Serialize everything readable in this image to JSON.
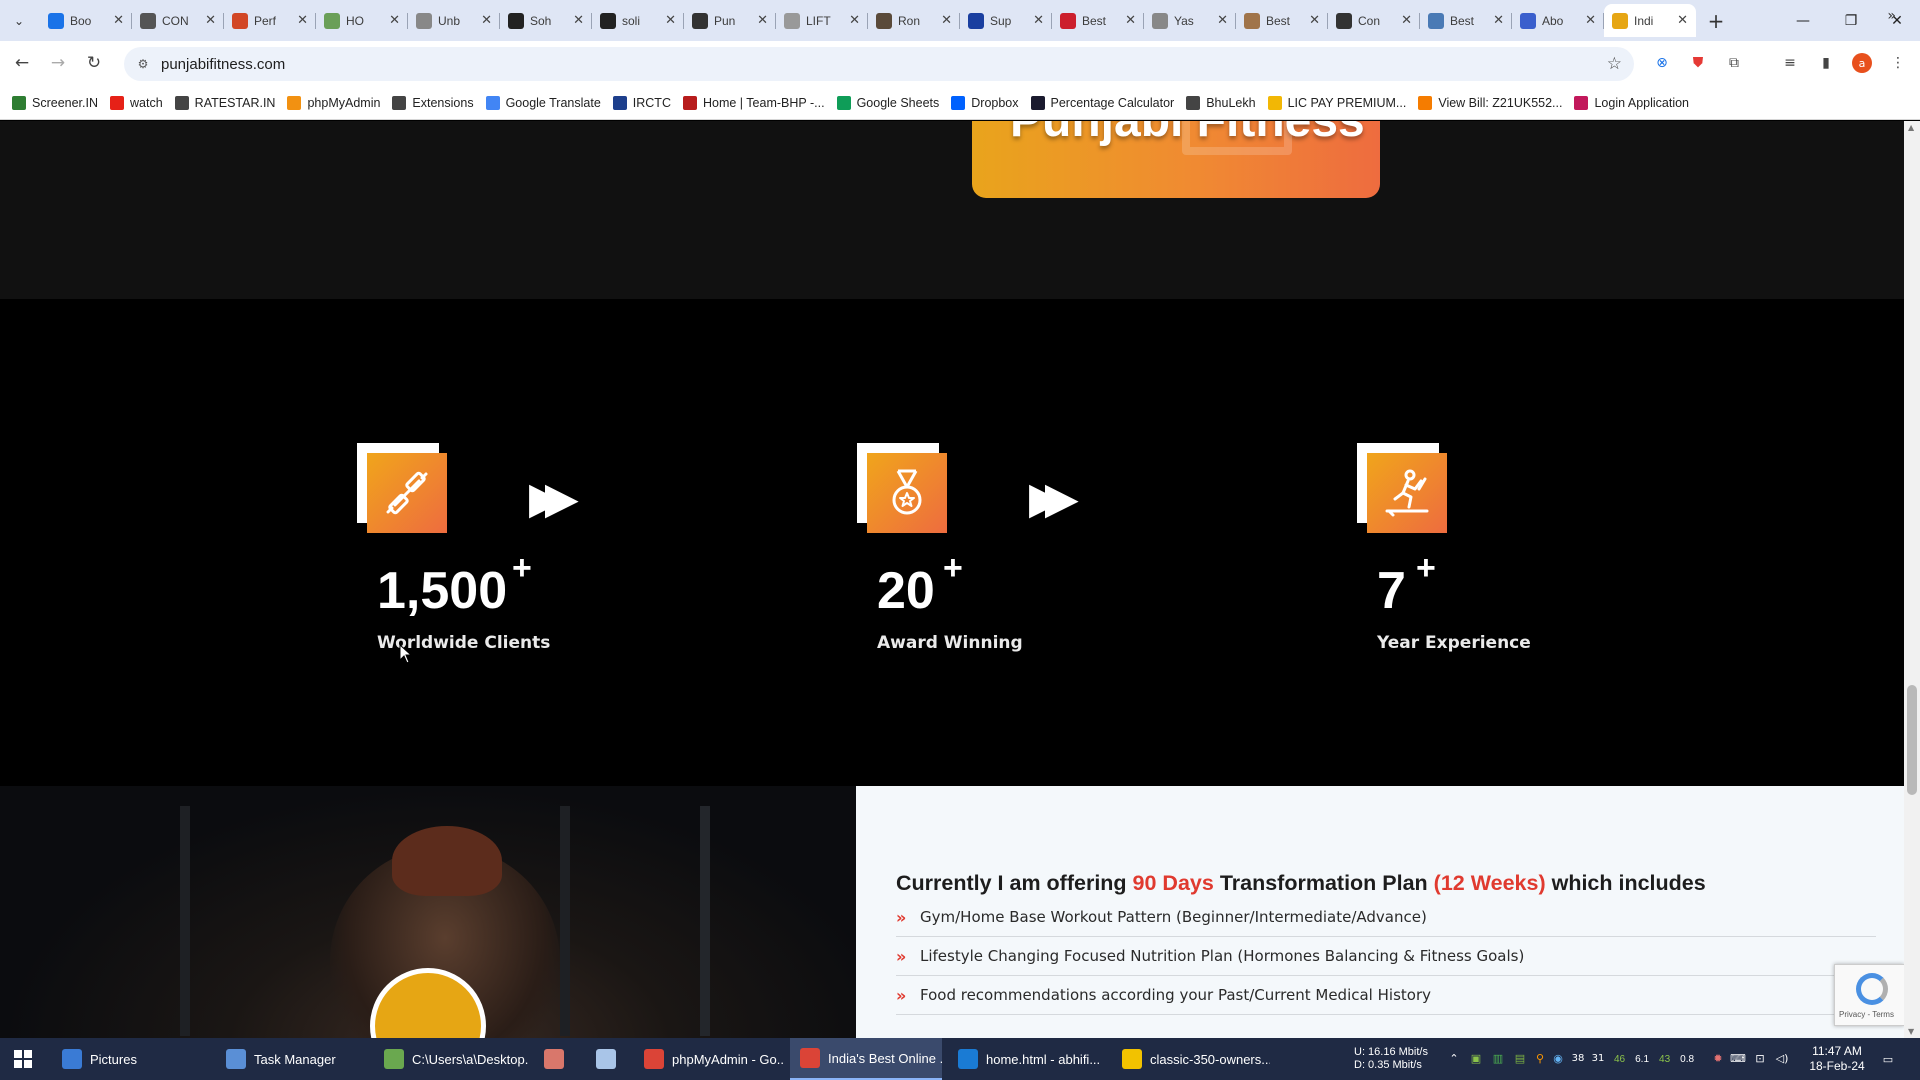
{
  "browser": {
    "tabs": [
      {
        "title": "Boo",
        "icon": "star-icon",
        "color": "#1a73e8"
      },
      {
        "title": "CON",
        "icon": "page-icon",
        "color": "#555555"
      },
      {
        "title": "Perf",
        "icon": "powerpoint-icon",
        "color": "#d24726"
      },
      {
        "title": "HO",
        "icon": "check-icon",
        "color": "#6a9f58"
      },
      {
        "title": "Unb",
        "icon": "doc-icon",
        "color": "#888888"
      },
      {
        "title": "Soh",
        "icon": "ssl-icon",
        "color": "#222222"
      },
      {
        "title": "soli",
        "icon": "s-icon",
        "color": "#222222"
      },
      {
        "title": "Pun",
        "icon": "dash-icon",
        "color": "#333333"
      },
      {
        "title": "LIFT",
        "icon": "doc-icon",
        "color": "#999999"
      },
      {
        "title": "Ron",
        "icon": "rs-icon",
        "color": "#5a4a3a"
      },
      {
        "title": "Sup",
        "icon": "circle-icon",
        "color": "#1a3fa0"
      },
      {
        "title": "Best",
        "icon": "flag-icon",
        "color": "#cc1f2d"
      },
      {
        "title": "Yas",
        "icon": "image-icon",
        "color": "#888888"
      },
      {
        "title": "Best",
        "icon": "hand-icon",
        "color": "#a0744a"
      },
      {
        "title": "Con",
        "icon": "window-icon",
        "color": "#333333"
      },
      {
        "title": "Best",
        "icon": "clock-icon",
        "color": "#4a7ab5"
      },
      {
        "title": "Abo",
        "icon": "ws-icon",
        "color": "#3a5fcd"
      },
      {
        "title": "Indi",
        "icon": "pf-icon",
        "color": "#e6a614",
        "active": true
      }
    ],
    "url": "punjabifitness.com",
    "bookmarks": [
      {
        "label": "Screener.IN",
        "icon": "bars-icon",
        "color": "#2e7d32"
      },
      {
        "label": "watch",
        "icon": "youtube-icon",
        "color": "#e62117"
      },
      {
        "label": "RATESTAR.IN",
        "icon": "star-icon",
        "color": "#444444"
      },
      {
        "label": "phpMyAdmin",
        "icon": "sail-icon",
        "color": "#f29111"
      },
      {
        "label": "Extensions",
        "icon": "puzzle-icon",
        "color": "#444444"
      },
      {
        "label": "Google Translate",
        "icon": "translate-icon",
        "color": "#4285f4"
      },
      {
        "label": "IRCTC",
        "icon": "irctc-icon",
        "color": "#1d3f8c"
      },
      {
        "label": "Home | Team-BHP -...",
        "icon": "bhp-icon",
        "color": "#b71c1c"
      },
      {
        "label": "Google Sheets",
        "icon": "sheets-icon",
        "color": "#0f9d58"
      },
      {
        "label": "Dropbox",
        "icon": "dropbox-icon",
        "color": "#0061fe"
      },
      {
        "label": "Percentage Calculator",
        "icon": "percent-icon",
        "color": "#1a1a2e"
      },
      {
        "label": "BhuLekh",
        "icon": "globe-icon",
        "color": "#444444"
      },
      {
        "label": "LIC PAY PREMIUM...",
        "icon": "lic-icon",
        "color": "#f2b705"
      },
      {
        "label": "View Bill: Z21UK552...",
        "icon": "bill-icon",
        "color": "#f57c00"
      },
      {
        "label": "Login Application",
        "icon": "login-icon",
        "color": "#c2185b"
      }
    ]
  },
  "page": {
    "logo_text": "Punjabi Fitness",
    "stats": [
      {
        "value": "1,500",
        "suffix": "+",
        "label": "Worldwide Clients",
        "icon": "dumbbell-icon"
      },
      {
        "value": "20",
        "suffix": "+",
        "label": "Award Winning",
        "icon": "medal-icon"
      },
      {
        "value": "7",
        "suffix": "+",
        "label": "Year Experience",
        "icon": "treadmill-icon"
      }
    ],
    "offer": {
      "heading_pre": "Currently I am offering ",
      "heading_days": "90 Days",
      "heading_mid": " Transformation Plan ",
      "heading_weeks": "(12 Weeks)",
      "heading_post": " which includes",
      "items": [
        "Gym/Home Base Workout Pattern (Beginner/Intermediate/Advance)",
        "Lifestyle Changing Focused Nutrition Plan (Hormones Balancing & Fitness Goals)",
        "Food recommendations according your Past/Current Medical History"
      ]
    },
    "recaptcha": "Privacy - Terms"
  },
  "taskbar": {
    "apps": [
      {
        "label": "Pictures",
        "icon": "pictures-icon",
        "color": "#3a7bd5"
      },
      {
        "label": "Task Manager",
        "icon": "taskmanager-icon",
        "color": "#5a8fd6"
      },
      {
        "label": "C:\\Users\\a\\Desktop...",
        "icon": "notepadpp-icon",
        "color": "#6aa84f"
      },
      {
        "label": "",
        "icon": "app-icon",
        "color": "#d9776b"
      },
      {
        "label": "",
        "icon": "notepad-icon",
        "color": "#a9c5e8"
      },
      {
        "label": "phpMyAdmin - Go...",
        "icon": "chrome-icon",
        "color": "#db4437"
      },
      {
        "label": "India's Best Online ...",
        "icon": "chrome-icon",
        "color": "#db4437",
        "active": true
      },
      {
        "label": "home.html - abhifi...",
        "icon": "vscode-icon",
        "color": "#1a7bd4"
      },
      {
        "label": "classic-350-owners...",
        "icon": "pw-icon",
        "color": "#f2c200"
      }
    ],
    "net_up": "U:  16.16 Mbit/s",
    "net_down": "D:    0.35 Mbit/s",
    "tray_nums": [
      "46",
      "6.1",
      "43",
      "0.8"
    ],
    "time": "11:47 AM",
    "date": "18-Feb-24"
  }
}
